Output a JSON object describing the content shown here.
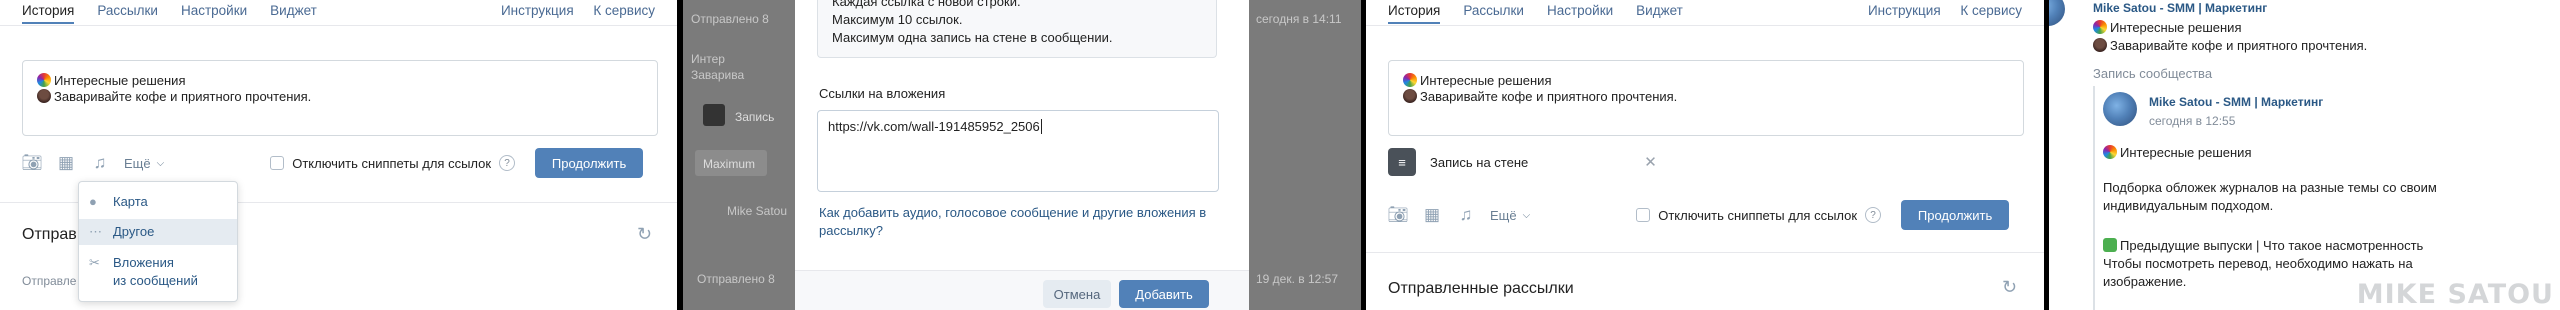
{
  "tabs": [
    "История",
    "Рассылки",
    "Настройки",
    "Виджет"
  ],
  "tabs_right": [
    "Инструкция",
    "К сервису"
  ],
  "message": {
    "line1": "Интересные решения",
    "line2": "Заваривайте кофе и приятного прочтения."
  },
  "toolbar": {
    "more_label": "Ещё",
    "disable_snippets_label": "Отключить сниппеты для ссылок",
    "help_glyph": "?",
    "continue_label": "Продолжить"
  },
  "dropdown": [
    "Карта",
    "Другое",
    "Вложения",
    "из сообщений"
  ],
  "sent_heading_short": "Отправ",
  "sent_row_short": "Отправле",
  "sent_heading": "Отправленные рассылки",
  "attachment": {
    "label": "Запись на стене"
  },
  "modal": {
    "notice_cut": "Каждая ссылка с новой строки.",
    "notice_line2": "Максимум 10 ссылок.",
    "notice_line3": "Максимум одна запись на стене в сообщении.",
    "label": "Ссылки на вложения",
    "value": "https://vk.com/wall-191485952_2506",
    "help_link": "Как добавить аудио, голосовое сообщение и другие вложения в рассылку?",
    "cancel": "Отмена",
    "add": "Добавить"
  },
  "bg": {
    "sent_cut": "Отправлено 8",
    "msg1": "Интер",
    "msg2": "Заварива",
    "attach_cut": "Запись",
    "maximum": "Maximum",
    "author_cut": "Mike Satou",
    "date_top": "сегодня в 14:11",
    "date_bottom": "19 дек. в 12:57"
  },
  "post": {
    "top_author": "Mike Satou - SMM | Маркетинг",
    "top_line1": "Интересные решения",
    "top_line2": "Заваривайте кофе и приятного прочтения.",
    "community_label": "Запись сообщества",
    "author": "Mike Satou - SMM | Маркетинг",
    "time": "сегодня в 12:55",
    "line1": "Интересные решения",
    "body1": "Подборка обложек журналов на разные темы со своим",
    "body2": "индивидуальным подходом.",
    "prev": "Предыдущие выпуски | Что такое насмотренность",
    "translate1": "Чтобы посмотреть перевод, необходимо нажать на",
    "translate2": "изображение.",
    "watermark": "MIKE SATOU"
  }
}
